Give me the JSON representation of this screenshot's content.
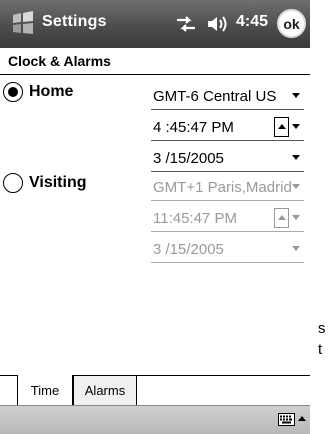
{
  "titlebar": {
    "title": "Settings",
    "clock": "4:45",
    "ok_label": "ok",
    "start_icon": "windows-flag-icon",
    "connectivity_icon": "connectivity-icon",
    "volume_icon": "volume-icon"
  },
  "header": {
    "title": "Clock & Alarms"
  },
  "home": {
    "label": "Home",
    "selected": true,
    "timezone": "GMT-6 Central US",
    "time": "4 :45:47 PM",
    "date": "3 /15/2005"
  },
  "visiting": {
    "label": "Visiting",
    "selected": false,
    "timezone": "GMT+1 Paris,Madrid",
    "time": "11:45:47 PM",
    "date": "3 /15/2005"
  },
  "tabs": [
    {
      "label": "Time",
      "active": true
    },
    {
      "label": "Alarms",
      "active": false
    }
  ],
  "edge_text": [
    "s",
    "t"
  ],
  "colors": {
    "titlebar": "#4d4d4d",
    "menubar": "#c4c4c4",
    "disabled_text": "#9a9a9a"
  }
}
